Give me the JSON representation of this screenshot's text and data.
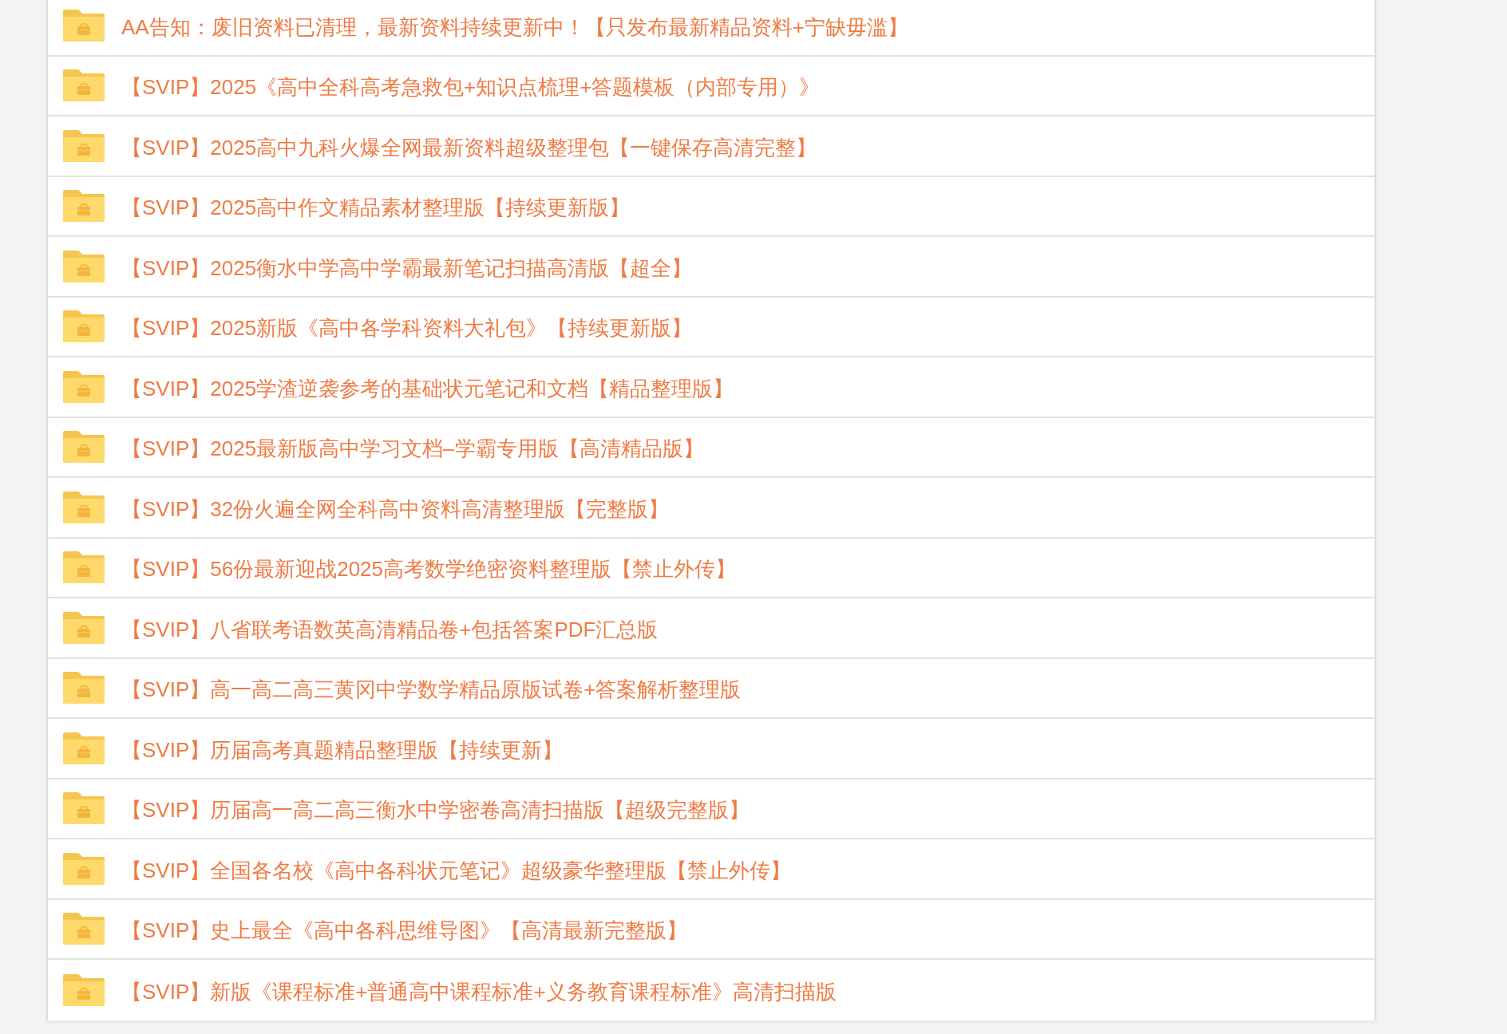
{
  "folders": [
    {
      "title": "AA告知：废旧资料已清理，最新资料持续更新中！【只发布最新精品资料+宁缺毋滥】"
    },
    {
      "title": "【SVIP】2025《高中全科高考急救包+知识点梳理+答题模板（内部专用）》"
    },
    {
      "title": "【SVIP】2025高中九科火爆全网最新资料超级整理包【一键保存高清完整】"
    },
    {
      "title": "【SVIP】2025高中作文精品素材整理版【持续更新版】"
    },
    {
      "title": "【SVIP】2025衡水中学高中学霸最新笔记扫描高清版【超全】"
    },
    {
      "title": "【SVIP】2025新版《高中各学科资料大礼包》【持续更新版】"
    },
    {
      "title": "【SVIP】2025学渣逆袭参考的基础状元笔记和文档【精品整理版】"
    },
    {
      "title": "【SVIP】2025最新版高中学习文档–学霸专用版【高清精品版】"
    },
    {
      "title": "【SVIP】32份火遍全网全科高中资料高清整理版【完整版】"
    },
    {
      "title": "【SVIP】56份最新迎战2025高考数学绝密资料整理版【禁止外传】"
    },
    {
      "title": "【SVIP】八省联考语数英高清精品卷+包括答案PDF汇总版"
    },
    {
      "title": "【SVIP】高一高二高三黄冈中学数学精品原版试卷+答案解析整理版"
    },
    {
      "title": "【SVIP】历届高考真题精品整理版【持续更新】"
    },
    {
      "title": "【SVIP】历届高一高二高三衡水中学密卷高清扫描版【超级完整版】"
    },
    {
      "title": "【SVIP】全国各名校《高中各科状元笔记》超级豪华整理版【禁止外传】"
    },
    {
      "title": "【SVIP】史上最全《高中各科思维导图》【高清最新完整版】"
    },
    {
      "title": "【SVIP】新版《课程标准+普通高中课程标准+义务教育课程标准》高清扫描版"
    }
  ]
}
